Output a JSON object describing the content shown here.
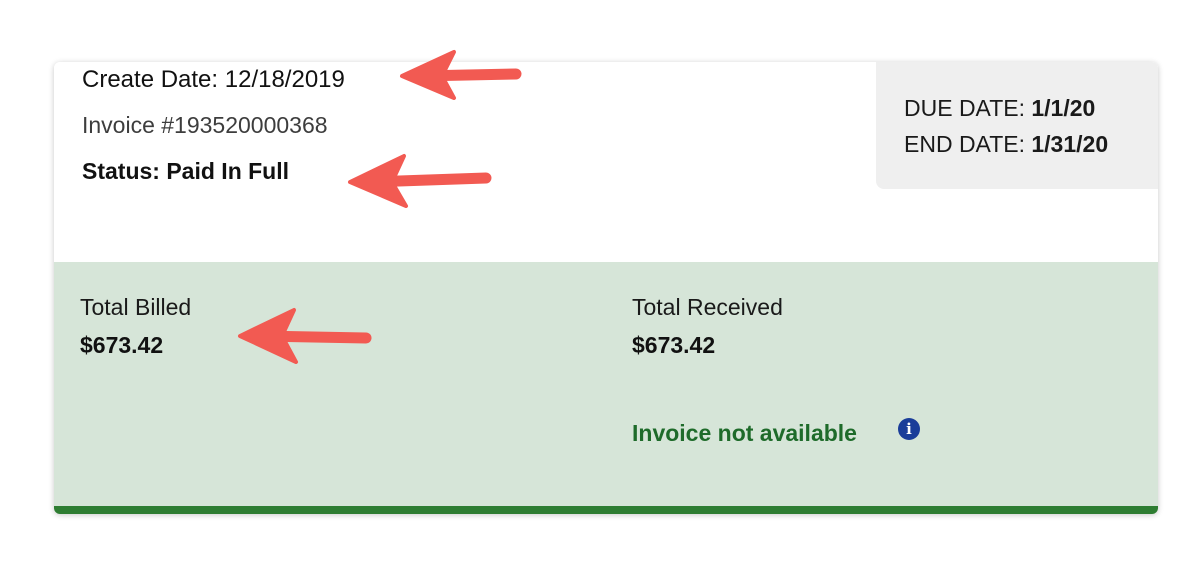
{
  "invoice": {
    "create_date_label": "Create Date:",
    "create_date": "12/18/2019",
    "invoice_number": "Invoice #193520000368",
    "status_text": "Status: Paid In Full"
  },
  "dates": {
    "due_label": "DUE DATE:",
    "due_value": "1/1/20",
    "end_label": "END DATE:",
    "end_value": "1/31/20"
  },
  "totals": {
    "billed_label": "Total Billed",
    "billed_value": "$673.42",
    "received_label": "Total Received",
    "received_value": "$673.42"
  },
  "availability": {
    "message": "Invoice not available",
    "info_glyph": "i"
  },
  "annotation_arrows": {
    "color": "#f25a52",
    "points_to": [
      "create-date",
      "status",
      "total-billed"
    ]
  },
  "colors": {
    "summary_background": "#d6e5d8",
    "accent_bar": "#2e7d32",
    "not_available_text": "#1e6b2a",
    "info_icon": "#1a3d99",
    "dates_box_background": "#efefef"
  }
}
